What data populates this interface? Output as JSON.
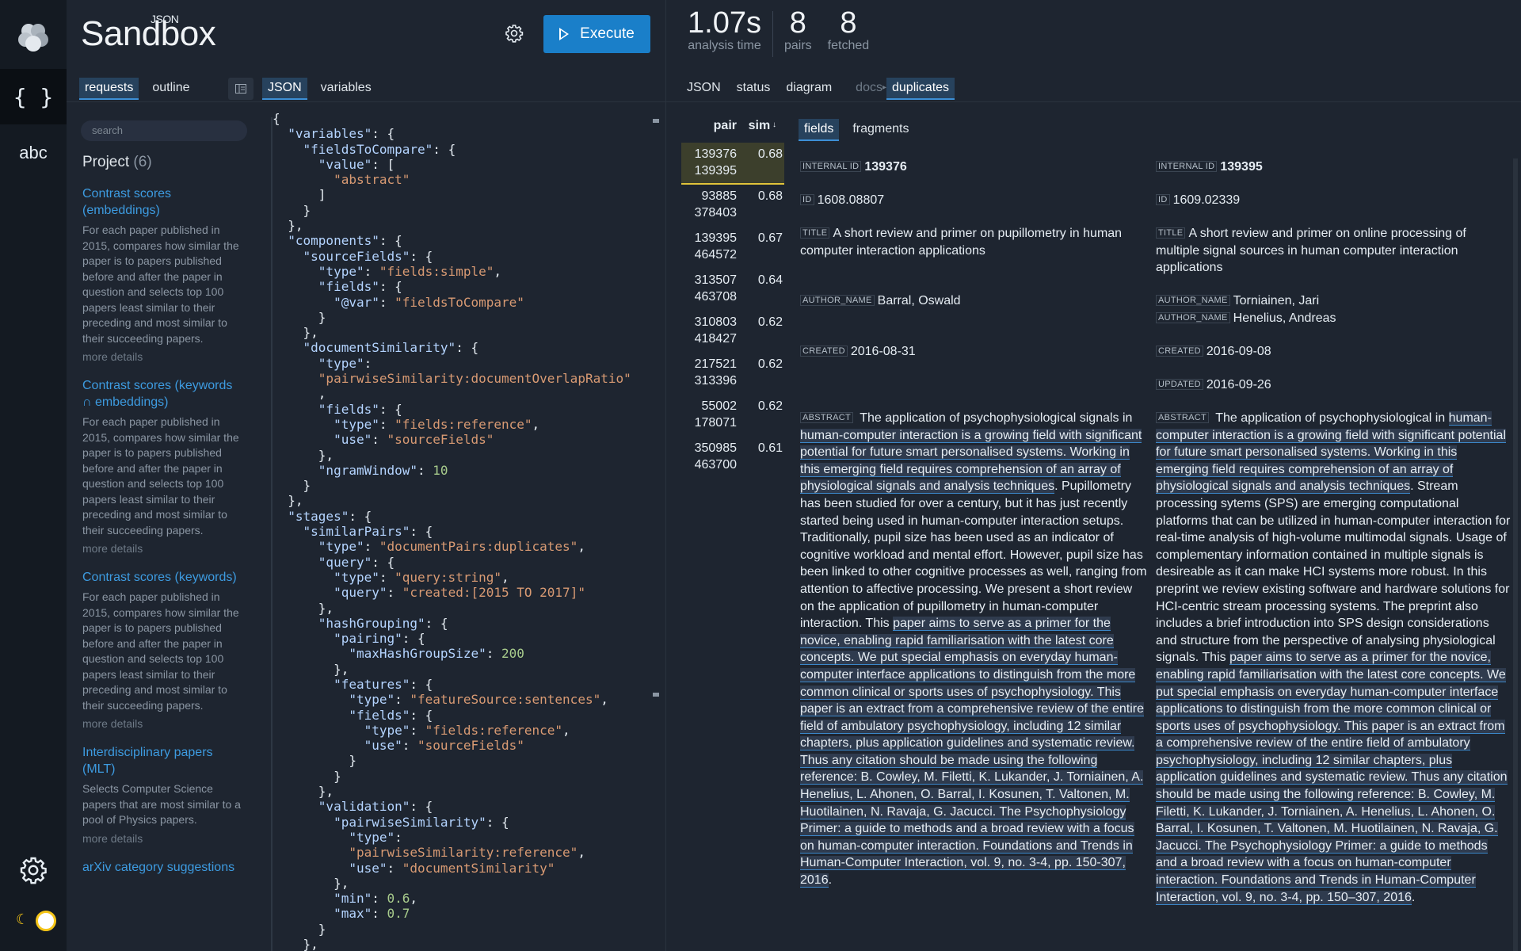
{
  "app": {
    "title": "Sandbox",
    "superscript": "JSON",
    "execute_label": "Execute"
  },
  "stats": [
    {
      "value": "1.07s",
      "label": "analysis time"
    },
    {
      "value": "8",
      "label": "pairs"
    },
    {
      "value": "8",
      "label": "fetched"
    }
  ],
  "left_tabs": [
    "requests",
    "outline"
  ],
  "editor_tabs": [
    "JSON",
    "variables"
  ],
  "result_tabs": {
    "json": "JSON",
    "status": "status",
    "diagram": "diagram",
    "docs": "docs",
    "duplicates": "duplicates"
  },
  "search": {
    "placeholder": "search"
  },
  "project": {
    "label": "Project",
    "count": "(6)"
  },
  "projects": [
    {
      "title": "Contrast scores (embeddings)",
      "desc": "For each paper published in 2015, compares how similar the paper is to papers published before and after the paper in question and selects top 100 papers least similar to their preceding and most similar to their succeeding papers.",
      "more": "more details"
    },
    {
      "title": "Contrast scores (keywords ∩ embeddings)",
      "desc": "For each paper published in 2015, compares how similar the paper is to papers published before and after the paper in question and selects top 100 papers least similar to their preceding and most similar to their succeeding papers.",
      "more": "more details"
    },
    {
      "title": "Contrast scores (keywords)",
      "desc": "For each paper published in 2015, compares how similar the paper is to papers published before and after the paper in question and selects top 100 papers least similar to their preceding and most similar to their succeeding papers.",
      "more": "more details"
    },
    {
      "title": "Interdisciplinary papers (MLT)",
      "desc": "Selects Computer Science papers that are most similar to a pool of Physics papers.",
      "more": "more details"
    },
    {
      "title": "arXiv category suggestions",
      "desc": "",
      "more": ""
    }
  ],
  "pairs_table": {
    "headers": {
      "pair": "pair",
      "sim": "sim"
    },
    "rows": [
      {
        "a": "139376",
        "b": "139395",
        "sim": "0.68"
      },
      {
        "a": "93885",
        "b": "378403",
        "sim": "0.68"
      },
      {
        "a": "139395",
        "b": "464572",
        "sim": "0.67"
      },
      {
        "a": "313507",
        "b": "463708",
        "sim": "0.64"
      },
      {
        "a": "310803",
        "b": "418427",
        "sim": "0.62"
      },
      {
        "a": "217521",
        "b": "313396",
        "sim": "0.62"
      },
      {
        "a": "55002",
        "b": "178071",
        "sim": "0.62"
      },
      {
        "a": "350985",
        "b": "463700",
        "sim": "0.61"
      }
    ]
  },
  "detail_tabs": [
    "fields",
    "fragments"
  ],
  "labels": {
    "internal_id": "INTERNAL ID",
    "id": "ID",
    "title": "TITLE",
    "author": "AUTHOR_NAME",
    "created": "CREATED",
    "updated": "UPDATED",
    "abstract": "ABSTRACT"
  },
  "doc_left": {
    "internal_id": "139376",
    "id": "1608.08807",
    "title": "A short review and primer on pupillometry in human computer interaction applications",
    "authors": [
      "Barral, Oswald"
    ],
    "created": "2016-08-31",
    "abstract_pre": "The application of psychophysiological signals in ",
    "abstract_hl1": "human-computer interaction is a growing field with significant potential for future smart personalised systems. Working in this emerging field requires comprehension of an array of physiological signals and analysis techniques",
    "abstract_mid": ". Pupillometry has been studied for over a century, but it has just recently started being used in human-computer interaction setups. Traditionally, pupil size has been used as an indicator of cognitive workload and mental effort. However, pupil size has been linked to other cognitive processes as well, ranging from attention to affective processing. We present a short review on the application of pupillometry in human-computer interaction. This ",
    "abstract_hl2": "paper aims to serve as a primer for the novice, enabling rapid familiarisation with the latest core concepts. We put special emphasis on everyday human-computer interface applications to distinguish from the more common clinical or sports uses of psychophysiology. This paper is an extract from a comprehensive review of the entire field of ambulatory psychophysiology, including 12 similar chapters, plus application guidelines and systematic review. Thus any citation should be made using the following reference: B. Cowley, M. Filetti, K. Lukander, J. Torniainen, A. Henelius, L. Ahonen, O. Barral, I. Kosunen, T. Valtonen, M. Huotilainen, N. Ravaja, G. Jacucci. The Psychophysiology Primer: a guide to methods and a broad review with a focus on human-computer interaction. Foundations and Trends in Human-Computer Interaction, vol. 9, no. 3-4, pp. 150-307, 2016",
    "abstract_end": "."
  },
  "doc_right": {
    "internal_id": "139395",
    "id": "1609.02339",
    "title": "A short review and primer on online processing of multiple signal sources in human computer interaction applications",
    "authors": [
      "Torniainen, Jari",
      "Henelius, Andreas"
    ],
    "created": "2016-09-08",
    "updated": "2016-09-26",
    "abstract_pre": "The application of psychophysiological in ",
    "abstract_hl1": "human-computer interaction is a growing field with significant potential for future smart personalised systems. Working in this emerging field requires comprehension of an array of physiological signals and analysis techniques",
    "abstract_mid": ". Stream processing sytems (SPS) are emerging computational platforms that can be utilized in human-computer interaction for real-time analysis of high-volume multimodal signals. Usage of complementary information contained in multiple signals is desireable as it can make HCI systems more robust. In this preprint we review existing software and hardware solutions for HCI-centric stream processing systems. The preprint also includes a brief introduction into SPS design considerations and structure from the perspective of analysing physiological signals. This ",
    "abstract_hl2": "paper aims to serve as a primer for the novice, enabling rapid familiarisation with the latest core concepts. We put special emphasis on everyday human-computer interface applications to distinguish from the more common clinical or sports uses of psychophysiology. This paper is an extract from a comprehensive review of the entire field of ambulatory psychophysiology, including 12 similar chapters, plus application guidelines and systematic review. Thus any citation should be made using the following reference: B. Cowley, M. Filetti, K. Lukander, J. Torniainen, A. Henelius, L. Ahonen, O. Barral, I. Kosunen, T. Valtonen, M. Huotilainen, N. Ravaja, G. Jacucci. The Psychophysiology Primer: a guide to methods and a broad review with a focus on human-computer interaction. Foundations and Trends in Human-Computer Interaction, vol. 9, no. 3-4, pp. 150–307, 2016",
    "abstract_end": "."
  },
  "editor_code": [
    [
      [
        "p",
        "{"
      ]
    ],
    [
      [
        "p",
        "  "
      ],
      [
        "k",
        "\"variables\""
      ],
      [
        "p",
        ": {"
      ]
    ],
    [
      [
        "p",
        "    "
      ],
      [
        "k",
        "\"fieldsToCompare\""
      ],
      [
        "p",
        ": {"
      ]
    ],
    [
      [
        "p",
        "      "
      ],
      [
        "k",
        "\"value\""
      ],
      [
        "p",
        ": ["
      ]
    ],
    [
      [
        "p",
        "        "
      ],
      [
        "s",
        "\"abstract\""
      ]
    ],
    [
      [
        "p",
        "      ]"
      ]
    ],
    [
      [
        "p",
        "    }"
      ]
    ],
    [
      [
        "p",
        "  },"
      ]
    ],
    [
      [
        "p",
        "  "
      ],
      [
        "k",
        "\"components\""
      ],
      [
        "p",
        ": {"
      ]
    ],
    [
      [
        "p",
        "    "
      ],
      [
        "k",
        "\"sourceFields\""
      ],
      [
        "p",
        ": {"
      ]
    ],
    [
      [
        "p",
        "      "
      ],
      [
        "k",
        "\"type\""
      ],
      [
        "p",
        ": "
      ],
      [
        "s",
        "\"fields:simple\""
      ],
      [
        "p",
        ","
      ]
    ],
    [
      [
        "p",
        "      "
      ],
      [
        "k",
        "\"fields\""
      ],
      [
        "p",
        ": {"
      ]
    ],
    [
      [
        "p",
        "        "
      ],
      [
        "k",
        "\"@var\""
      ],
      [
        "p",
        ": "
      ],
      [
        "s",
        "\"fieldsToCompare\""
      ]
    ],
    [
      [
        "p",
        "      }"
      ]
    ],
    [
      [
        "p",
        "    },"
      ]
    ],
    [
      [
        "p",
        "    "
      ],
      [
        "k",
        "\"documentSimilarity\""
      ],
      [
        "p",
        ": {"
      ]
    ],
    [
      [
        "p",
        "      "
      ],
      [
        "k",
        "\"type\""
      ],
      [
        "p",
        ":"
      ]
    ],
    [
      [
        "p",
        "      "
      ],
      [
        "s",
        "\"pairwiseSimilarity:documentOverlapRatio\""
      ]
    ],
    [
      [
        "p",
        "      ,"
      ]
    ],
    [
      [
        "p",
        "      "
      ],
      [
        "k",
        "\"fields\""
      ],
      [
        "p",
        ": {"
      ]
    ],
    [
      [
        "p",
        "        "
      ],
      [
        "k",
        "\"type\""
      ],
      [
        "p",
        ": "
      ],
      [
        "s",
        "\"fields:reference\""
      ],
      [
        "p",
        ","
      ]
    ],
    [
      [
        "p",
        "        "
      ],
      [
        "k",
        "\"use\""
      ],
      [
        "p",
        ": "
      ],
      [
        "s",
        "\"sourceFields\""
      ]
    ],
    [
      [
        "p",
        "      },"
      ]
    ],
    [
      [
        "p",
        "      "
      ],
      [
        "k",
        "\"ngramWindow\""
      ],
      [
        "p",
        ": "
      ],
      [
        "n",
        "10"
      ]
    ],
    [
      [
        "p",
        "    }"
      ]
    ],
    [
      [
        "p",
        "  },"
      ]
    ],
    [
      [
        "p",
        "  "
      ],
      [
        "k",
        "\"stages\""
      ],
      [
        "p",
        ": {"
      ]
    ],
    [
      [
        "p",
        "    "
      ],
      [
        "k",
        "\"similarPairs\""
      ],
      [
        "p",
        ": {"
      ]
    ],
    [
      [
        "p",
        "      "
      ],
      [
        "k",
        "\"type\""
      ],
      [
        "p",
        ": "
      ],
      [
        "s",
        "\"documentPairs:duplicates\""
      ],
      [
        "p",
        ","
      ]
    ],
    [
      [
        "p",
        "      "
      ],
      [
        "k",
        "\"query\""
      ],
      [
        "p",
        ": {"
      ]
    ],
    [
      [
        "p",
        "        "
      ],
      [
        "k",
        "\"type\""
      ],
      [
        "p",
        ": "
      ],
      [
        "s",
        "\"query:string\""
      ],
      [
        "p",
        ","
      ]
    ],
    [
      [
        "p",
        "        "
      ],
      [
        "k",
        "\"query\""
      ],
      [
        "p",
        ": "
      ],
      [
        "s",
        "\"created:[2015 TO 2017]\""
      ]
    ],
    [
      [
        "p",
        "      },"
      ]
    ],
    [
      [
        "p",
        "      "
      ],
      [
        "k",
        "\"hashGrouping\""
      ],
      [
        "p",
        ": {"
      ]
    ],
    [
      [
        "p",
        "        "
      ],
      [
        "k",
        "\"pairing\""
      ],
      [
        "p",
        ": {"
      ]
    ],
    [
      [
        "p",
        "          "
      ],
      [
        "k",
        "\"maxHashGroupSize\""
      ],
      [
        "p",
        ": "
      ],
      [
        "n",
        "200"
      ]
    ],
    [
      [
        "p",
        "        },"
      ]
    ],
    [
      [
        "p",
        "        "
      ],
      [
        "k",
        "\"features\""
      ],
      [
        "p",
        ": {"
      ]
    ],
    [
      [
        "p",
        "          "
      ],
      [
        "k",
        "\"type\""
      ],
      [
        "p",
        ": "
      ],
      [
        "s",
        "\"featureSource:sentences\""
      ],
      [
        "p",
        ","
      ]
    ],
    [
      [
        "p",
        "          "
      ],
      [
        "k",
        "\"fields\""
      ],
      [
        "p",
        ": {"
      ]
    ],
    [
      [
        "p",
        "            "
      ],
      [
        "k",
        "\"type\""
      ],
      [
        "p",
        ": "
      ],
      [
        "s",
        "\"fields:reference\""
      ],
      [
        "p",
        ","
      ]
    ],
    [
      [
        "p",
        "            "
      ],
      [
        "k",
        "\"use\""
      ],
      [
        "p",
        ": "
      ],
      [
        "s",
        "\"sourceFields\""
      ]
    ],
    [
      [
        "p",
        "          }"
      ]
    ],
    [
      [
        "p",
        "        }"
      ]
    ],
    [
      [
        "p",
        "      },"
      ]
    ],
    [
      [
        "p",
        "      "
      ],
      [
        "k",
        "\"validation\""
      ],
      [
        "p",
        ": {"
      ]
    ],
    [
      [
        "p",
        "        "
      ],
      [
        "k",
        "\"pairwiseSimilarity\""
      ],
      [
        "p",
        ": {"
      ]
    ],
    [
      [
        "p",
        "          "
      ],
      [
        "k",
        "\"type\""
      ],
      [
        "p",
        ":"
      ]
    ],
    [
      [
        "p",
        "          "
      ],
      [
        "s",
        "\"pairwiseSimilarity:reference\""
      ],
      [
        "p",
        ","
      ]
    ],
    [
      [
        "p",
        "          "
      ],
      [
        "k",
        "\"use\""
      ],
      [
        "p",
        ": "
      ],
      [
        "s",
        "\"documentSimilarity\""
      ]
    ],
    [
      [
        "p",
        "        },"
      ]
    ],
    [
      [
        "p",
        "        "
      ],
      [
        "k",
        "\"min\""
      ],
      [
        "p",
        ": "
      ],
      [
        "n",
        "0.6"
      ],
      [
        "p",
        ","
      ]
    ],
    [
      [
        "p",
        "        "
      ],
      [
        "k",
        "\"max\""
      ],
      [
        "p",
        ": "
      ],
      [
        "n",
        "0.7"
      ]
    ],
    [
      [
        "p",
        "      }"
      ]
    ],
    [
      [
        "p",
        "    },"
      ]
    ]
  ]
}
